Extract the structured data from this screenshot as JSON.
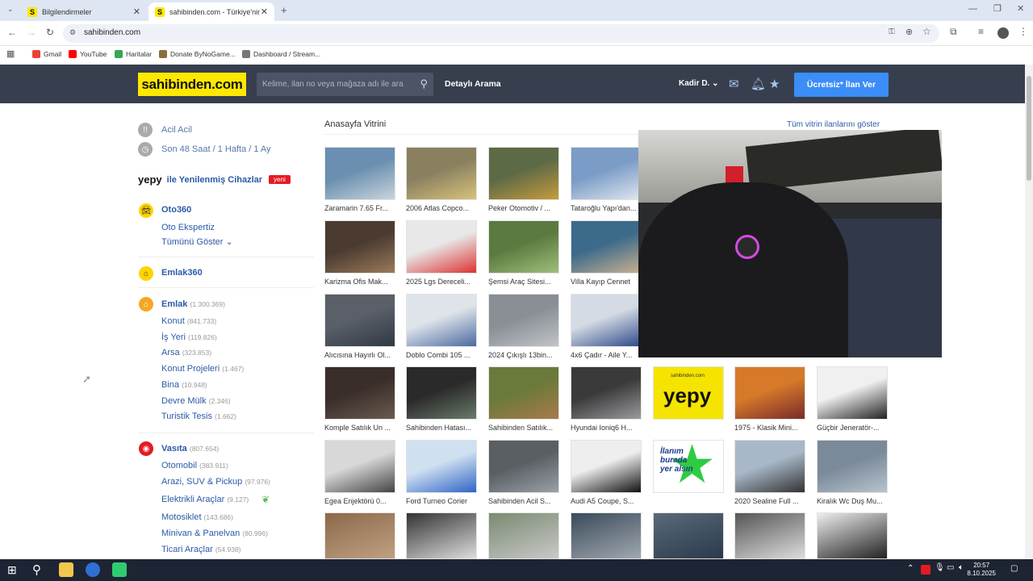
{
  "browser": {
    "tabs": [
      {
        "title": "Bilgilendirmeler",
        "fav": "S"
      },
      {
        "title": "sahibinden.com - Türkiye'nin O",
        "fav": "S"
      }
    ],
    "url": "sahibinden.com",
    "bookmarks": [
      "Gmail",
      "YouTube",
      "Haritalar",
      "Donate ByNoGame...",
      "Dashboard / Stream..."
    ]
  },
  "header": {
    "logo": "sahibinden.com",
    "search_placeholder": "Kelime, ilan no veya mağaza adı ile ara",
    "detailed_search": "Detaylı Arama",
    "user": "Kadir D.",
    "cta": "Ücretsiz* İlan Ver"
  },
  "sidebar": {
    "urgent": "Acil Acil",
    "recent": "Son 48 Saat / 1 Hafta / 1 Ay",
    "yepy_brand": "yepy",
    "yepy_label": "ile Yenilenmiş Cihazlar",
    "yepy_badge": "yeni",
    "oto360": "Oto360",
    "oto_ekspertiz": "Oto Ekspertiz",
    "show_all": "Tümünü Göster",
    "emlak360": "Emlak360",
    "emlak": {
      "label": "Emlak",
      "count": "(1.300.369)"
    },
    "emlak_items": [
      {
        "label": "Konut",
        "count": "(841.733)"
      },
      {
        "label": "İş Yeri",
        "count": "(119.826)"
      },
      {
        "label": "Arsa",
        "count": "(323.853)"
      },
      {
        "label": "Konut Projeleri",
        "count": "(1.467)"
      },
      {
        "label": "Bina",
        "count": "(10.948)"
      },
      {
        "label": "Devre Mülk",
        "count": "(2.346)"
      },
      {
        "label": "Turistik Tesis",
        "count": "(1.662)"
      }
    ],
    "vasita": {
      "label": "Vasıta",
      "count": "(807.654)"
    },
    "vasita_items": [
      {
        "label": "Otomobil",
        "count": "(383.911)"
      },
      {
        "label": "Arazi, SUV & Pickup",
        "count": "(97.976)"
      },
      {
        "label": "Elektrikli Araçlar",
        "count": "(9.127)"
      },
      {
        "label": "Motosiklet",
        "count": "(143.686)"
      },
      {
        "label": "Minivan & Panelvan",
        "count": "(80.996)"
      },
      {
        "label": "Ticari Araçlar",
        "count": "(54.938)"
      }
    ]
  },
  "showcase": {
    "title": "Anasayfa Vitrini",
    "show_all": "Tüm vitrin ilanlarını göster",
    "rows": [
      [
        "Zaramarin 7.65 Fr...",
        "2006 Atlas Copco...",
        "Peker Otomotiv / ...",
        "Tataroğlu Yapı'dan..."
      ],
      [
        "Karizma Ofis Mak...",
        "2025 Lgs Dereceli...",
        "Şemsi Araç Sitesi...",
        "Villa Kayıp Cennet"
      ],
      [
        "Alıcısına Hayırlı Ol...",
        "Doblo Combi 105 ...",
        "2024 Çıkışlı 13bin...",
        "4x6 Çadır - Aile Y..."
      ],
      [
        "Komple Satılık Un ...",
        "Sahibinden Hatası...",
        "Sahibinden Satılık...",
        "Hyundai Ioniq6 H...",
        "",
        "1975 - Klasik Mini...",
        "Güçbir Jeneratör-..."
      ],
      [
        "Egea Enjektörü 0...",
        "Ford Turneo Corier",
        "Sahibinden Acil S...",
        "Audi A5 Coupe, S...",
        "",
        "2020 Sealine Full ...",
        "Kiralık Wc Duş Mu..."
      ]
    ],
    "yepy_ad": "yepy",
    "yepy_ad_small": "sahibinden.com",
    "ilan_ad": [
      "İlanım",
      "burada",
      "yer alsın"
    ]
  },
  "taskbar": {
    "time": "20:57",
    "date": "8.10.2025"
  },
  "colors": {
    "brand_yellow": "#ffe800",
    "header_bg": "#373f4f",
    "cta_blue": "#3b8df7",
    "link_blue": "#2b5aa8"
  }
}
